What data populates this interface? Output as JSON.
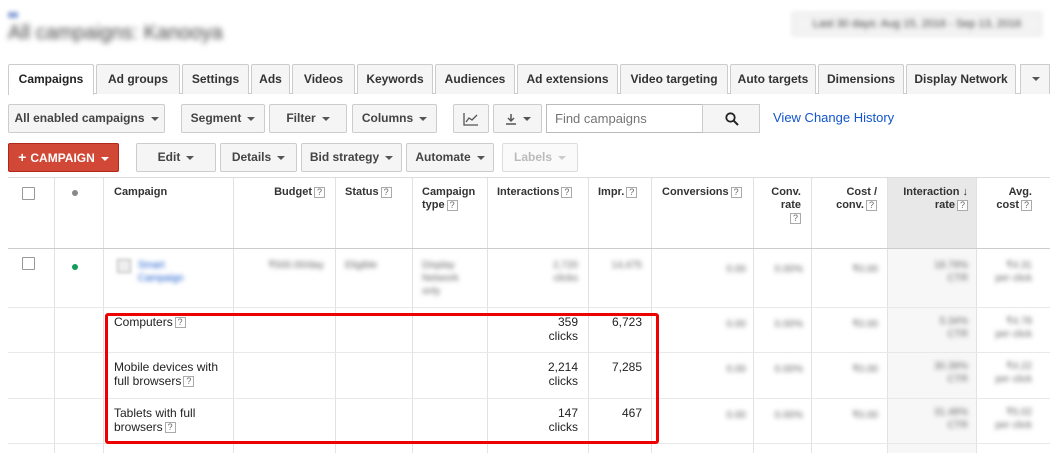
{
  "header": {
    "title": "All campaigns: Kanooya",
    "date_range": "Last 30 days: Aug 15, 2016 - Sep 13, 2016"
  },
  "tabs": [
    "Campaigns",
    "Ad groups",
    "Settings",
    "Ads",
    "Videos",
    "Keywords",
    "Audiences",
    "Ad extensions",
    "Video targeting",
    "Auto targets",
    "Dimensions",
    "Display Network"
  ],
  "toolbar": {
    "filter_scope": "All enabled campaigns",
    "segment": "Segment",
    "filter": "Filter",
    "columns": "Columns",
    "search_placeholder": "Find campaigns",
    "view_history": "View Change History",
    "campaign_button": "CAMPAIGN",
    "edit": "Edit",
    "details": "Details",
    "bid_strategy": "Bid strategy",
    "automate": "Automate",
    "labels": "Labels"
  },
  "table": {
    "columns": {
      "campaign": "Campaign",
      "budget": "Budget",
      "status": "Status",
      "campaign_type": [
        "Campaign",
        "type"
      ],
      "interactions": "Interactions",
      "impr": "Impr.",
      "conversions": "Conversions",
      "conv_rate": [
        "Conv.",
        "rate"
      ],
      "cost_conv": [
        "Cost /",
        "conv."
      ],
      "interaction_rate": [
        "Interaction",
        "rate"
      ],
      "avg_cost": [
        "Avg.",
        "cost"
      ]
    },
    "campaign_row": {
      "name": [
        "Smart",
        "Campaign"
      ],
      "budget": "₹500.00/day",
      "status": "Eligible",
      "type": [
        "Display",
        "Network",
        "only"
      ],
      "interactions": [
        "2,720",
        "clicks"
      ],
      "impr": "14,475",
      "conversions": "0.00",
      "conv_rate": "0.00%",
      "cost_conv": "₹0.00",
      "interaction_rate": [
        "18.79%",
        "CTR"
      ],
      "avg_cost": [
        "₹4.31",
        "per click"
      ]
    },
    "segments": [
      {
        "label": "Computers",
        "interactions": "359",
        "interaction_unit": "clicks",
        "impr": "6,723",
        "conversions": "0.00",
        "conv_rate": "0.00%",
        "cost_conv": "₹0.00",
        "interaction_rate": [
          "5.34%",
          "CTR"
        ],
        "avg_cost": [
          "₹4.78",
          "per click"
        ]
      },
      {
        "label": "Mobile devices with full browsers",
        "interactions": "2,214",
        "interaction_unit": "clicks",
        "impr": "7,285",
        "conversions": "0.00",
        "conv_rate": "0.00%",
        "cost_conv": "₹0.00",
        "interaction_rate": [
          "30.39%",
          "CTR"
        ],
        "avg_cost": [
          "₹4.22",
          "per click"
        ]
      },
      {
        "label": "Tablets with full browsers",
        "interactions": "147",
        "interaction_unit": "clicks",
        "impr": "467",
        "conversions": "0.00",
        "conv_rate": "0.00%",
        "cost_conv": "₹0.00",
        "interaction_rate": [
          "31.48%",
          "CTR"
        ],
        "avg_cost": [
          "₹5.02",
          "per click"
        ]
      }
    ]
  },
  "colors": {
    "accent_red": "#d14836",
    "link_blue": "#15c",
    "status_green": "#0f9d58",
    "highlight_red": "#e00"
  }
}
